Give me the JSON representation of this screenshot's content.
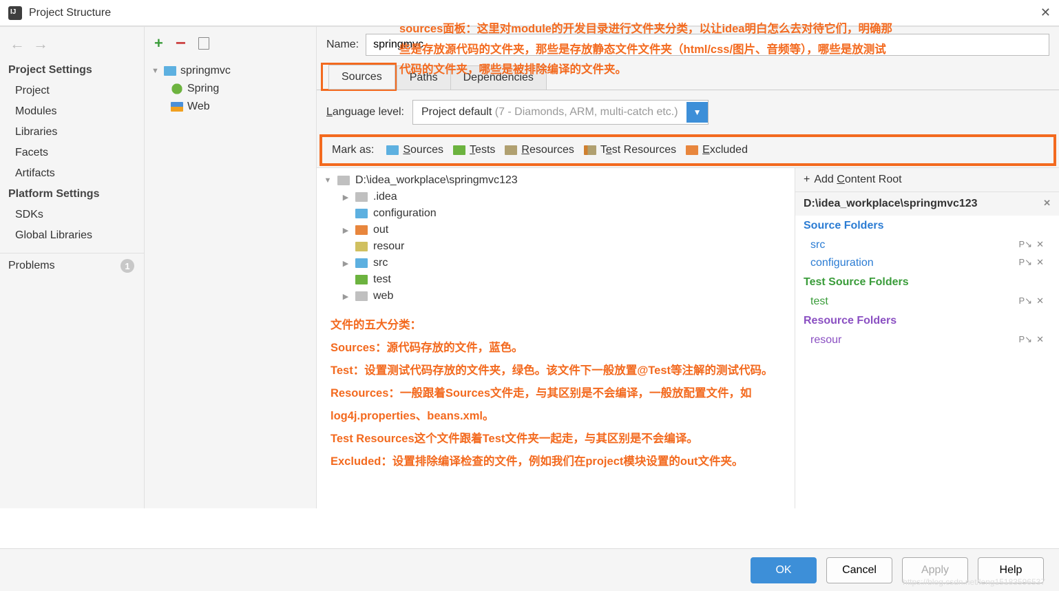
{
  "window": {
    "title": "Project Structure",
    "close": "✕"
  },
  "annotTop": [
    "sources面板：这里对module的开发目录进行文件夹分类，以让idea明白怎么去对待它们，明确那",
    "些是存放源代码的文件夹，那些是存放静态文件文件夹（html/css/图片、音频等），哪些是放测试",
    "代码的文件夹，哪些是被排除编译的文件夹。"
  ],
  "left": {
    "projectSettings": "Project Settings",
    "items1": [
      "Project",
      "Modules",
      "Libraries",
      "Facets",
      "Artifacts"
    ],
    "platformSettings": "Platform Settings",
    "items2": [
      "SDKs",
      "Global Libraries"
    ],
    "problems": "Problems",
    "problemCount": "1"
  },
  "middle": {
    "module": "springmvc",
    "children": [
      "Spring",
      "Web"
    ]
  },
  "right": {
    "nameLabel": "Name:",
    "nameValue": "springmvc",
    "tabs": [
      "Sources",
      "Paths",
      "Dependencies"
    ],
    "langLabel": "Language level:",
    "langValue": "Project default ",
    "langHint": "(7 - Diamonds, ARM, multi-catch etc.)",
    "markAsLabel": "Mark as:",
    "markBtns": [
      "Sources",
      "Tests",
      "Resources",
      "Test Resources",
      "Excluded"
    ],
    "treeRoot": "D:\\idea_workplace\\springmvc123",
    "treeItems": [
      {
        "name": ".idea",
        "color": "grey",
        "exp": "▶"
      },
      {
        "name": "configuration",
        "color": "blue",
        "exp": ""
      },
      {
        "name": "out",
        "color": "orange",
        "exp": "▶"
      },
      {
        "name": "resour",
        "color": "yell",
        "exp": ""
      },
      {
        "name": "src",
        "color": "blue",
        "exp": "▶"
      },
      {
        "name": "test",
        "color": "green",
        "exp": ""
      },
      {
        "name": "web",
        "color": "grey",
        "exp": "▶"
      }
    ],
    "side": {
      "addRoot": "Add Content Root",
      "rootPath": "D:\\idea_workplace\\springmvc123",
      "groups": [
        {
          "title": "Source Folders",
          "color": "blue",
          "entries": [
            "src",
            "configuration"
          ]
        },
        {
          "title": "Test Source Folders",
          "color": "green",
          "entries": [
            "test"
          ]
        },
        {
          "title": "Resource Folders",
          "color": "purple",
          "entries": [
            "resour"
          ]
        }
      ]
    }
  },
  "annotBody": [
    "文件的五大分类：",
    "Sources：源代码存放的文件，蓝色。",
    "Test：设置测试代码存放的文件夹，绿色。该文件下一般放置@Test等注解的测试代码。",
    "Resources：一般跟着Sources文件走，与其区别是不会编译，一般放配置文件，如log4j.properties、beans.xml。",
    "Test Resources这个文件跟着Test文件夹一起走，与其区别是不会编译。",
    "Excluded：设置排除编译检查的文件，例如我们在project模块设置的out文件夹。"
  ],
  "footer": {
    "ok": "OK",
    "cancel": "Cancel",
    "apply": "Apply",
    "help": "Help"
  },
  "watermark": "https://blog.csdn.net/leng15183596537"
}
